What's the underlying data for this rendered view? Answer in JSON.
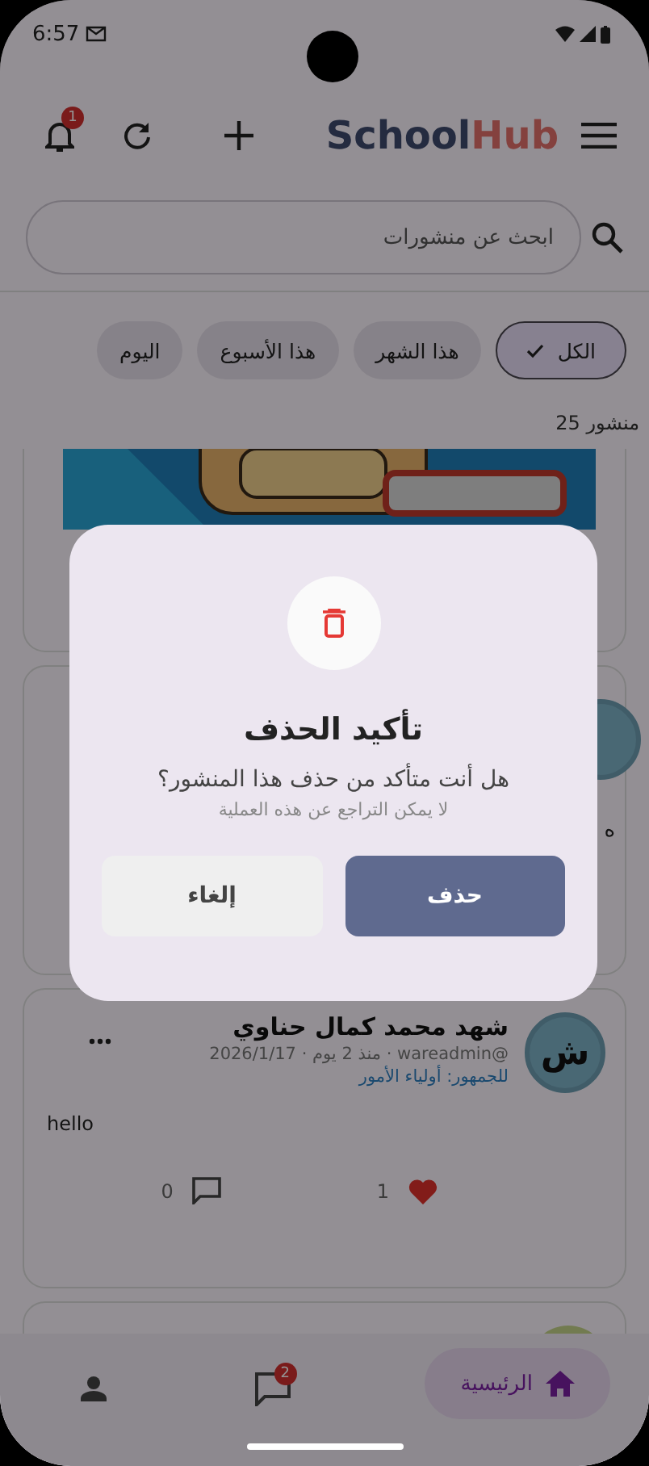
{
  "status_bar": {
    "time": "6:57"
  },
  "header": {
    "logo": {
      "primary": "School",
      "accent": "Hub"
    },
    "notification_count": "1"
  },
  "search": {
    "placeholder": "ابحث عن منشورات"
  },
  "filters": [
    {
      "label": "الكل",
      "selected": true
    },
    {
      "label": "هذا الشهر",
      "selected": false
    },
    {
      "label": "هذا الأسبوع",
      "selected": false
    },
    {
      "label": "اليوم",
      "selected": false
    }
  ],
  "post_count": "منشور 25",
  "posts": [
    {
      "kind": "image"
    },
    {
      "kind": "partial",
      "body": "ه"
    },
    {
      "kind": "full",
      "avatar": "ش",
      "author": "شهد محمد كمال حناوي",
      "meta": "@wareadmin · منذ 2 يوم · 2026/1/17",
      "audience": "للجمهور: أولياء الأمور",
      "body": "hello",
      "likes": "1",
      "liked": true,
      "comments": "0"
    },
    {
      "kind": "stub"
    }
  ],
  "dialog": {
    "title": "تأكيد الحذف",
    "message": "هل أنت متأكد من حذف هذا المنشور؟",
    "note": "لا يمكن التراجع عن هذه العملية",
    "buttons": [
      {
        "label": "حذف",
        "kind": "primary"
      },
      {
        "label": "إلغاء",
        "kind": "secondary"
      }
    ]
  },
  "bottom_nav": [
    {
      "kind": "home",
      "label": "الرئيسية",
      "selected": true
    },
    {
      "kind": "chat",
      "badge": "2",
      "selected": false
    },
    {
      "kind": "profile",
      "selected": false
    }
  ]
}
